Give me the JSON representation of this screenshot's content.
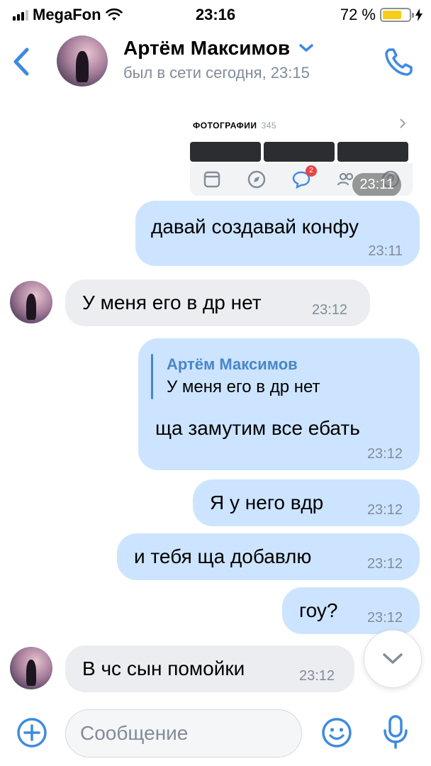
{
  "status_bar": {
    "carrier": "MegaFon",
    "time": "23:16",
    "battery": "72 %",
    "battery_level": 0.72
  },
  "header": {
    "name": "Артём Максимов",
    "status": "был в сети сегодня, 23:15",
    "back_icon": "chevron-left-icon",
    "call_icon": "phone-icon"
  },
  "attachment": {
    "title": "ФОТОГРАФИИ",
    "count": "345",
    "badge": "2",
    "time": "23:11"
  },
  "messages": [
    {
      "text": "давай создавай конфу",
      "time": "23:11",
      "direction": "out"
    },
    {
      "text": "У меня его в др нет",
      "time": "23:12",
      "direction": "in"
    },
    {
      "reply_name": "Артём Максимов",
      "reply_text": "У меня его в др нет",
      "text": "ща замутим все ебать",
      "time": "23:12",
      "direction": "out"
    },
    {
      "text": "Я у него вдр",
      "time": "23:12",
      "direction": "out"
    },
    {
      "text": "и тебя ща добавлю",
      "time": "23:12",
      "direction": "out"
    },
    {
      "text": "гоу?",
      "time": "23:12",
      "direction": "out"
    },
    {
      "text": "В чс сын помойки",
      "time": "23:12",
      "direction": "in"
    }
  ],
  "composer": {
    "placeholder": "Сообщение"
  },
  "colors": {
    "accent": "#3f8ae0",
    "outgoing_bubble": "#cce4ff",
    "incoming_bubble": "#ebedf0"
  }
}
